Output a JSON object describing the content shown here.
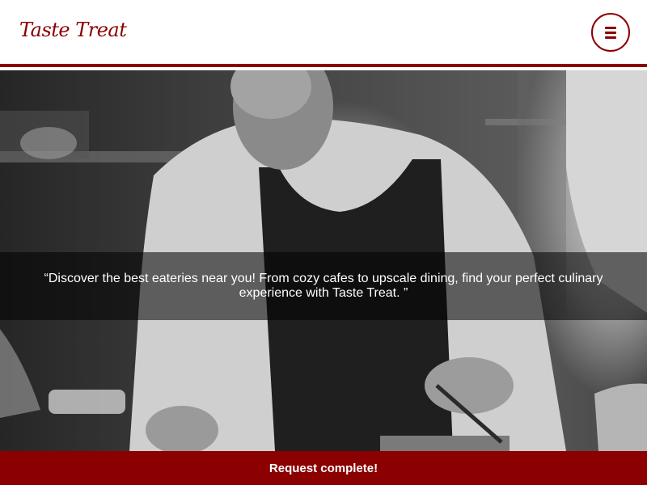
{
  "header": {
    "logo_text": "Taste Treat",
    "menu_icon": "hamburger-icon",
    "accent_color": "#8b0000"
  },
  "hero": {
    "image_description_icon": "chef-photo",
    "quote": "“Discover the best eateries near you! From cozy cafes to upscale dining, find your perfect culinary experience with Taste Treat. ”"
  },
  "toast": {
    "message": "Request complete!",
    "background_color": "#8b0000"
  }
}
